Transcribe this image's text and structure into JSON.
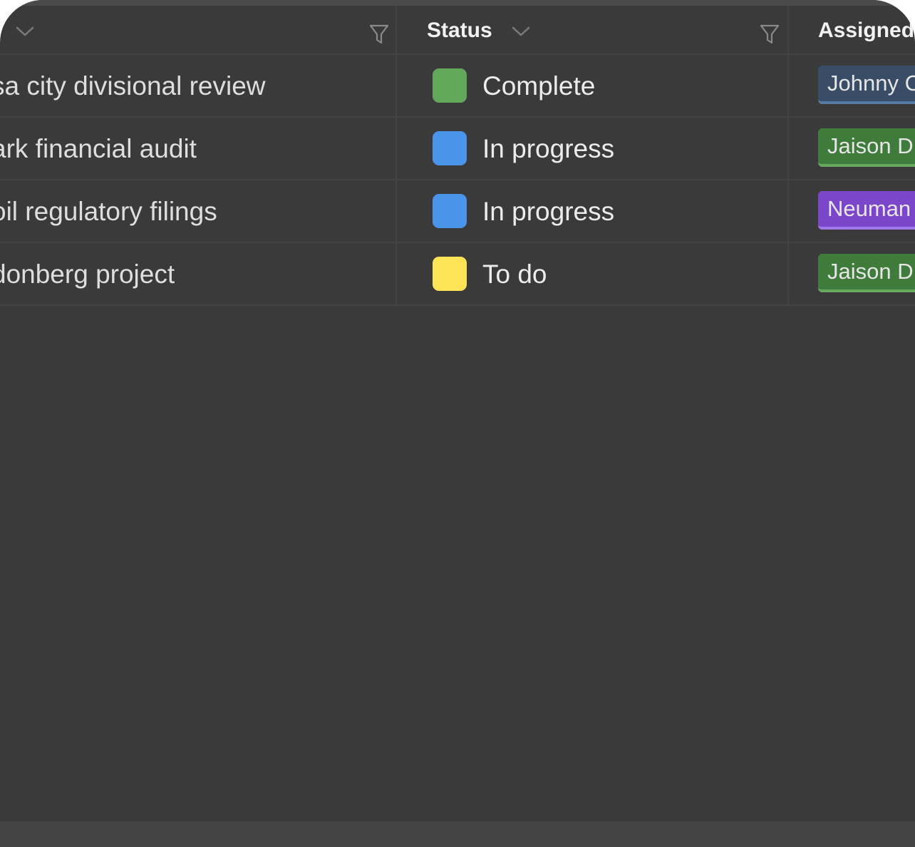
{
  "columns": {
    "status_label": "Status",
    "assigned_label": "Assigned"
  },
  "rows": [
    {
      "name": "sa city divisional review",
      "status": "Complete",
      "status_color": "#62a85a",
      "assignee": "Johnny C",
      "tag_bg": "#3a4d66",
      "tag_border": "#567ca6"
    },
    {
      "name": "ark financial audit",
      "status": "In progress",
      "status_color": "#4a94ea",
      "assignee": "Jaison D",
      "tag_bg": "#3f7b3a",
      "tag_border": "#67aa5d"
    },
    {
      "name": "oil regulatory filings",
      "status": "In progress",
      "status_color": "#4a94ea",
      "assignee": "Neuman",
      "tag_bg": "#7b46c9",
      "tag_border": "#a178e8"
    },
    {
      "name": "donberg project",
      "status": "To do",
      "status_color": "#fde356",
      "assignee": "Jaison D",
      "tag_bg": "#3f7b3a",
      "tag_border": "#67aa5d"
    }
  ]
}
